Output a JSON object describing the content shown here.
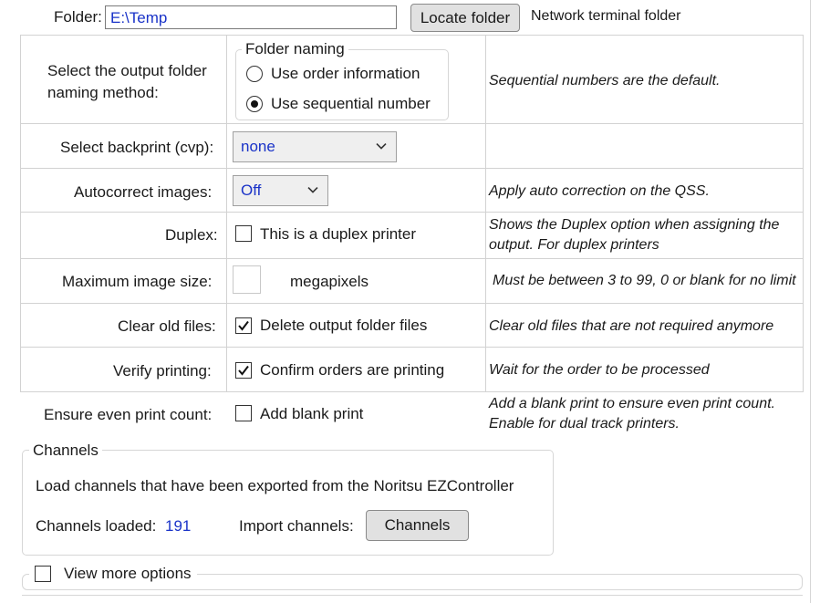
{
  "folder": {
    "label": "Folder:",
    "value": "E:\\Temp",
    "locate_button": "Locate folder",
    "note": "Network terminal folder"
  },
  "rows": {
    "naming": {
      "label_line1": "Select the output folder",
      "label_line2": "naming method:",
      "group_title": "Folder naming",
      "option1": "Use order information",
      "option2": "Use sequential number",
      "selected": "Use sequential number",
      "note": "Sequential numbers are the default."
    },
    "backprint": {
      "label": "Select backprint (cvp):",
      "value": "none"
    },
    "autocorrect": {
      "label": "Autocorrect images:",
      "value": "Off",
      "note": "Apply auto correction on the QSS."
    },
    "duplex": {
      "label": "Duplex:",
      "checkbox_label": "This is a duplex printer",
      "checked": false,
      "note_line1": "Shows the Duplex option when assigning the",
      "note_line2": "output. For duplex printers"
    },
    "max_image": {
      "label": "Maximum image size:",
      "value": "",
      "unit": "megapixels",
      "note": "Must be between 3 to 99, 0 or blank for no limit"
    },
    "clear_old": {
      "label": "Clear old files:",
      "checkbox_label": "Delete output folder files",
      "checked": true,
      "note": "Clear old files that are not required anymore"
    },
    "verify": {
      "label": "Verify printing:",
      "checkbox_label": "Confirm orders are printing",
      "checked": true,
      "note": "Wait for the order to be processed"
    },
    "even_count": {
      "label": "Ensure even print count:",
      "checkbox_label": "Add blank print",
      "checked": false,
      "note_line1": "Add a blank print to ensure even print count.",
      "note_line2": "Enable for dual track printers."
    }
  },
  "channels": {
    "title": "Channels",
    "description": "Load channels that have been exported from the Noritsu EZController",
    "loaded_label": "Channels loaded:",
    "loaded_count": "191",
    "import_label": "Import channels:",
    "import_button": "Channels"
  },
  "more_options": {
    "label": "View more options",
    "checked": false
  },
  "colors": {
    "value_text": "#1a33c8",
    "grid_lines": "#d2d2d2",
    "button_bg": "#e1e1e1"
  }
}
